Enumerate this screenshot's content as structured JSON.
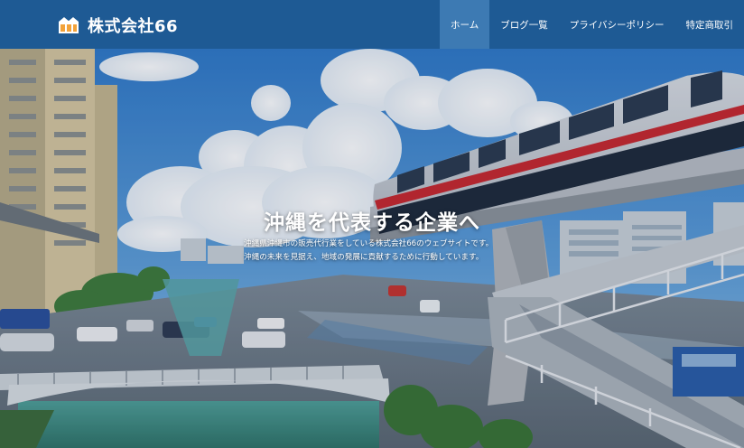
{
  "site": {
    "name": "株式会社66",
    "logo_icon": "building-blocks-icon",
    "header_color": "#1e5a94",
    "active_nav_color": "#3d7ab3"
  },
  "nav": {
    "items": [
      {
        "label": "ホーム",
        "active": true
      },
      {
        "label": "ブログ一覧",
        "active": false
      },
      {
        "label": "プライバシーポリシー",
        "active": false
      },
      {
        "label": "特定商取引",
        "active": false
      }
    ]
  },
  "hero": {
    "title": "沖縄を代表する企業へ",
    "description_line1": "沖縄県沖縄市の販売代行業をしている株式会社66のウェブサイトです。",
    "description_line2": "沖縄の未来を見据え、地域の発展に貢献するために行動しています。"
  }
}
